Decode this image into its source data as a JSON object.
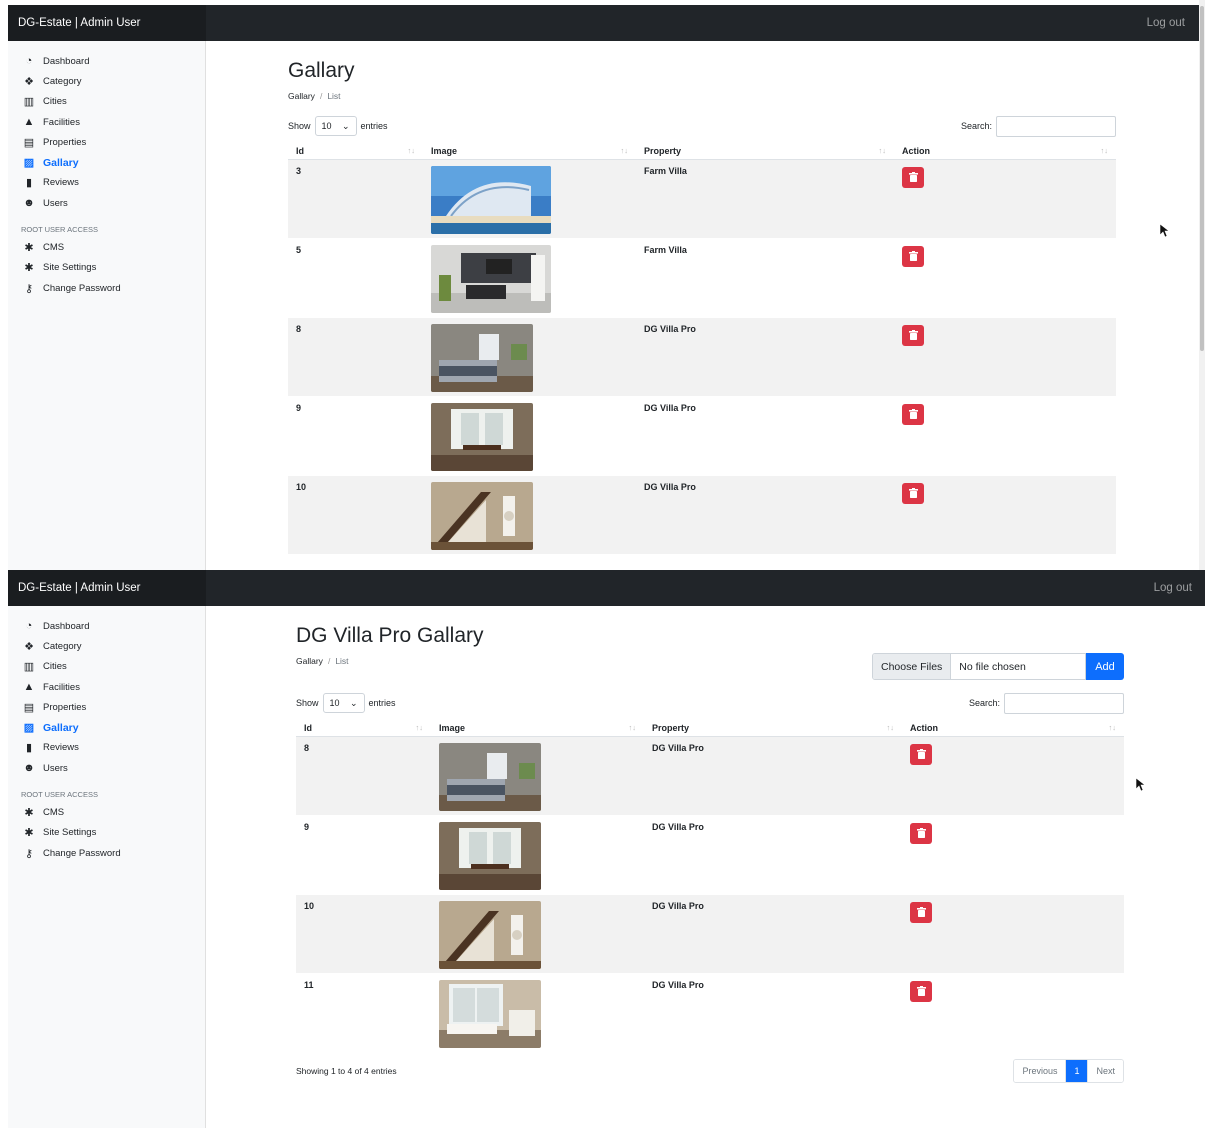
{
  "app": {
    "brand": "DG-Estate | Admin User",
    "logout": "Log out"
  },
  "sidebar": {
    "items": [
      {
        "label": "Dashboard",
        "icon": "dashboard-icon"
      },
      {
        "label": "Category",
        "icon": "cubes-icon"
      },
      {
        "label": "Cities",
        "icon": "city-icon"
      },
      {
        "label": "Facilities",
        "icon": "shapes-icon"
      },
      {
        "label": "Properties",
        "icon": "building-icon"
      },
      {
        "label": "Gallary",
        "icon": "image-icon",
        "active": true
      },
      {
        "label": "Reviews",
        "icon": "comment-icon"
      },
      {
        "label": "Users",
        "icon": "users-icon"
      }
    ],
    "heading": "ROOT USER ACCESS",
    "root_items": [
      {
        "label": "CMS",
        "icon": "gear-icon"
      },
      {
        "label": "Site Settings",
        "icon": "gear-icon"
      },
      {
        "label": "Change Password",
        "icon": "key-icon"
      }
    ]
  },
  "screen_a": {
    "title": "Gallary",
    "breadcrumb": [
      "Gallary",
      "List"
    ],
    "show_label": "Show",
    "entries_value": "10",
    "entries_label": "entries",
    "search_label": "Search:",
    "columns": [
      "Id",
      "Image",
      "Property",
      "Action"
    ],
    "rows": [
      {
        "id": "3",
        "property": "Farm Villa",
        "image": "hotel-photo"
      },
      {
        "id": "5",
        "property": "Farm Villa",
        "image": "living-room-photo"
      },
      {
        "id": "8",
        "property": "DG Villa Pro",
        "image": "bedroom-photo"
      },
      {
        "id": "9",
        "property": "DG Villa Pro",
        "image": "dining-room-photo"
      },
      {
        "id": "10",
        "property": "DG Villa Pro",
        "image": "staircase-photo"
      }
    ]
  },
  "screen_b": {
    "title": "DG Villa Pro Gallary",
    "breadcrumb": [
      "Gallary",
      "List"
    ],
    "file_button": "Choose Files",
    "file_status": "No file chosen",
    "add_button": "Add",
    "show_label": "Show",
    "entries_value": "10",
    "entries_label": "entries",
    "search_label": "Search:",
    "columns": [
      "Id",
      "Image",
      "Property",
      "Action"
    ],
    "rows": [
      {
        "id": "8",
        "property": "DG Villa Pro",
        "image": "bedroom-photo"
      },
      {
        "id": "9",
        "property": "DG Villa Pro",
        "image": "dining-room-photo"
      },
      {
        "id": "10",
        "property": "DG Villa Pro",
        "image": "staircase-photo"
      },
      {
        "id": "11",
        "property": "DG Villa Pro",
        "image": "bathroom-photo"
      }
    ],
    "info": "Showing 1 to 4 of 4 entries",
    "pager": {
      "previous": "Previous",
      "current": "1",
      "next": "Next"
    }
  },
  "colors": {
    "topbar": "#212529",
    "accent": "#0d6efd",
    "danger": "#dc3545"
  }
}
